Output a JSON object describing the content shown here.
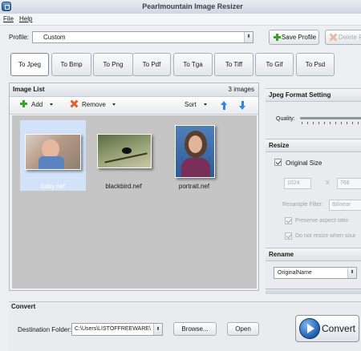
{
  "window": {
    "title": "Pearlmountain Image Resizer"
  },
  "menu": {
    "file": "File",
    "help": "Help"
  },
  "profile": {
    "label": "Profile:",
    "value": "Custom",
    "save_label": "Save Profile",
    "delete_label": "Delete Pr"
  },
  "format_tabs": [
    "To Jpeg",
    "To Bmp",
    "To Png",
    "To Pdf",
    "To Tga",
    "To Tiff",
    "To Gif",
    "To Psd"
  ],
  "image_list": {
    "title": "Image List",
    "count": "3 images",
    "toolbar": {
      "add": "Add",
      "remove": "Remove",
      "sort": "Sort"
    },
    "items": [
      {
        "filename": "baby.nef",
        "selected": true,
        "icon": "photo-baby"
      },
      {
        "filename": "blackbird.nef",
        "selected": false,
        "icon": "photo-bird"
      },
      {
        "filename": "portrait.nef",
        "selected": false,
        "icon": "photo-portrait"
      }
    ]
  },
  "jpeg_settings": {
    "title": "Jpeg Format Setting",
    "quality_label": "Quality:"
  },
  "resize": {
    "title": "Resize",
    "original_size_label": "Original Size",
    "original_size_checked": true,
    "width": "1024",
    "x_label": "X",
    "height": "768",
    "resample_label": "Resample Filter:",
    "resample_value": "Bilinear",
    "preserve_label": "Preserve aspect ratio",
    "no_resize_label": "Do not resize when sour"
  },
  "rename": {
    "title": "Rename",
    "value": "OriginalName"
  },
  "convert": {
    "title": "Convert",
    "dest_label": "Destination Folder:",
    "dest_value": "C:\\Users\\LISTOFFREEWARE\\",
    "browse_label": "Browse...",
    "open_label": "Open",
    "convert_label": "Convert"
  },
  "colors": {
    "accent_blue": "#2f87d9",
    "add_green": "#3aa12a",
    "remove_orange": "#e0622a",
    "selection": "#d2e2f9"
  }
}
